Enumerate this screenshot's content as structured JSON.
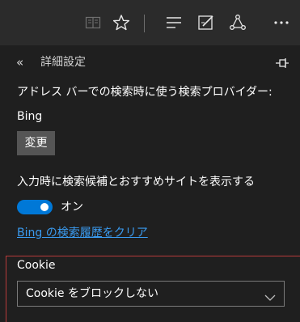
{
  "toolbar": {
    "icons": [
      "reading-view-icon",
      "favorite-star-icon",
      "hub-icon",
      "web-note-icon",
      "share-icon",
      "more-icon"
    ]
  },
  "pane": {
    "back_glyph": "«",
    "title": "詳細設定",
    "search_provider_label": "アドレス バーでの検索時に使う検索プロバイダー:",
    "search_provider_value": "Bing",
    "change_button": "変更",
    "suggestions_label": "入力時に検索候補とおすすめサイトを表示する",
    "suggestions_toggle": {
      "state": "オン",
      "on": true
    },
    "clear_history_link": "Bing の検索履歴をクリア",
    "cookie_label": "Cookie",
    "cookie_select_value": "Cookie をブロックしない"
  },
  "colors": {
    "accent": "#0078d7",
    "link": "#3a9bf0",
    "highlight_border": "#b73a3a"
  }
}
